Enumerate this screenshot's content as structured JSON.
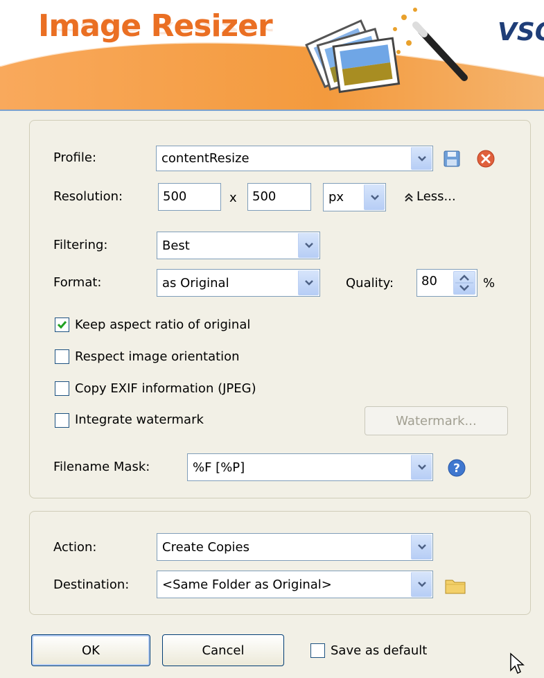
{
  "app": {
    "title": "Image Resizer",
    "brand": "VSO"
  },
  "profile": {
    "label": "Profile:",
    "value": "contentResize"
  },
  "resolution": {
    "label": "Resolution:",
    "width": "500",
    "separator": "x",
    "height": "500",
    "unit": "px",
    "less_label": "Less..."
  },
  "filtering": {
    "label": "Filtering:",
    "value": "Best"
  },
  "format": {
    "label": "Format:",
    "value": "as Original",
    "quality_label": "Quality:",
    "quality_value": "80",
    "quality_unit": "%"
  },
  "options": [
    {
      "label": "Keep aspect ratio of original",
      "checked": true
    },
    {
      "label": "Respect image orientation",
      "checked": false
    },
    {
      "label": "Copy EXIF information (JPEG)",
      "checked": false
    },
    {
      "label": "Integrate watermark",
      "checked": false
    }
  ],
  "watermark_button": "Watermark...",
  "filename_mask": {
    "label": "Filename Mask:",
    "value": "%F [%P]"
  },
  "action": {
    "label": "Action:",
    "value": "Create Copies"
  },
  "destination": {
    "label": "Destination:",
    "value": "<Same Folder as Original>"
  },
  "buttons": {
    "ok": "OK",
    "cancel": "Cancel"
  },
  "save_default": {
    "label": "Save as default",
    "checked": false
  },
  "colors": {
    "accent": "#ea6f23",
    "dialog_bg": "#f2f0e6",
    "field_border": "#7f9db9"
  }
}
